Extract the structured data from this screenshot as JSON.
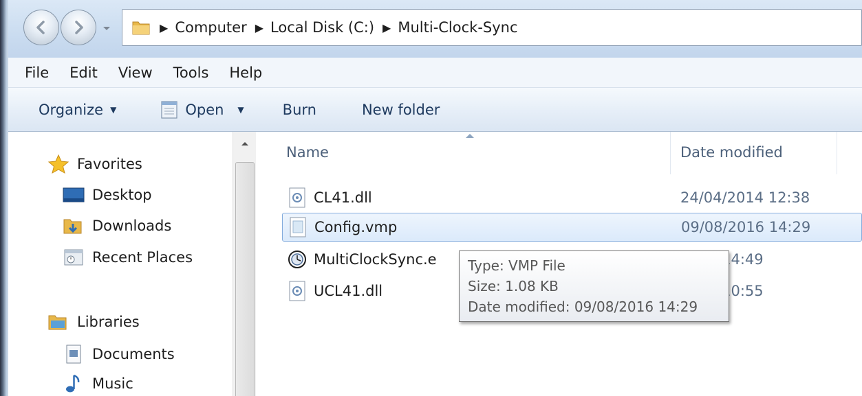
{
  "window": {
    "breadcrumbs": [
      "Computer",
      "Local Disk (C:)",
      "Multi-Clock-Sync"
    ]
  },
  "menubar": {
    "items": [
      "File",
      "Edit",
      "View",
      "Tools",
      "Help"
    ]
  },
  "toolbar": {
    "organize_label": "Organize",
    "open_label": "Open",
    "burn_label": "Burn",
    "new_folder_label": "New folder"
  },
  "navpane": {
    "favorites_label": "Favorites",
    "favorites": [
      "Desktop",
      "Downloads",
      "Recent Places"
    ],
    "libraries_label": "Libraries",
    "libraries": [
      "Documents",
      "Music"
    ]
  },
  "filelist": {
    "columns": {
      "name": "Name",
      "date": "Date modified"
    },
    "files": [
      {
        "name": "CL41.dll",
        "date": "24/04/2014 12:38",
        "icon": "dll-icon"
      },
      {
        "name": "Config.vmp",
        "date": "09/08/2016 14:29",
        "icon": "generic-file-icon",
        "selected": true
      },
      {
        "name": "MultiClockSync.e",
        "date": "2016 14:49",
        "icon": "app-clock-icon"
      },
      {
        "name": "UCL41.dll",
        "date": "2014 10:55",
        "icon": "dll-icon"
      }
    ]
  },
  "tooltip": {
    "type": "Type: VMP File",
    "size": "Size: 1.08 KB",
    "date": "Date modified: 09/08/2016 14:29"
  },
  "colors": {
    "selection_border": "#84acdd",
    "selection_fill": "#dbeafb",
    "toolbar_text": "#1e3a5f"
  }
}
